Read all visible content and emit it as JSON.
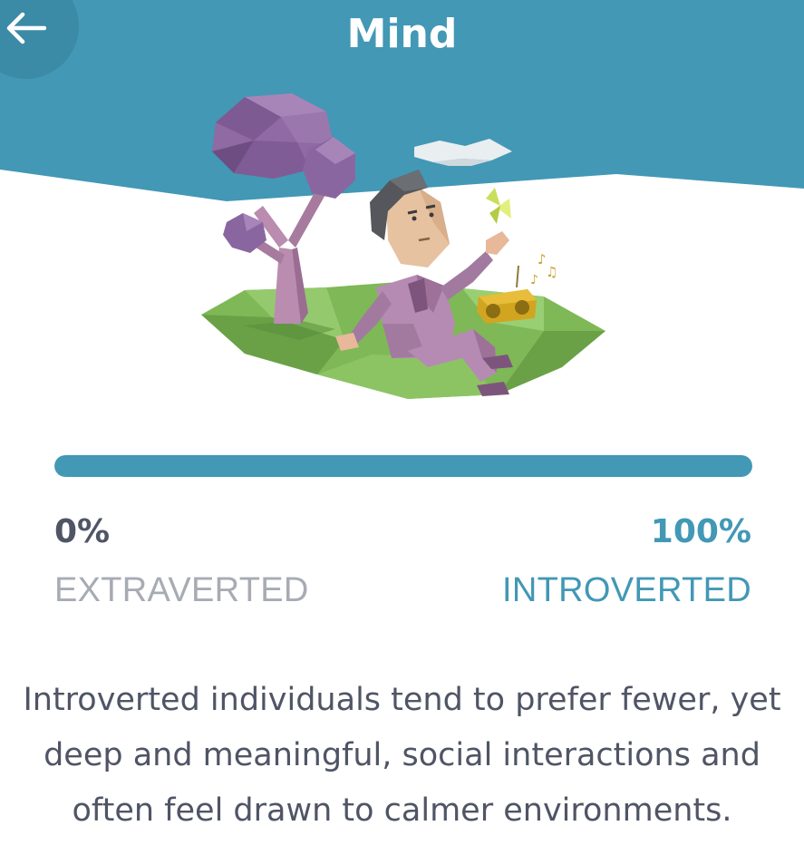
{
  "header": {
    "title": "Mind",
    "back_icon": "arrow-left-icon"
  },
  "colors": {
    "header_blue": "#4298b5",
    "back_circle": "#3b8ba7",
    "text_dark": "#4f5565",
    "text_muted": "#a7abb3",
    "accent_teal": "#4298b5"
  },
  "illustration": {
    "subject": "low-poly man sitting under purple tree with butterfly and radio"
  },
  "trait": {
    "progress_percent": 100,
    "left_percent": "0%",
    "right_percent": "100%",
    "left_label": "EXTRAVERTED",
    "right_label": "INTROVERTED"
  },
  "description": "Introverted individuals tend to prefer fewer, yet deep and meaningful, social interactions and often feel drawn to calmer environments."
}
